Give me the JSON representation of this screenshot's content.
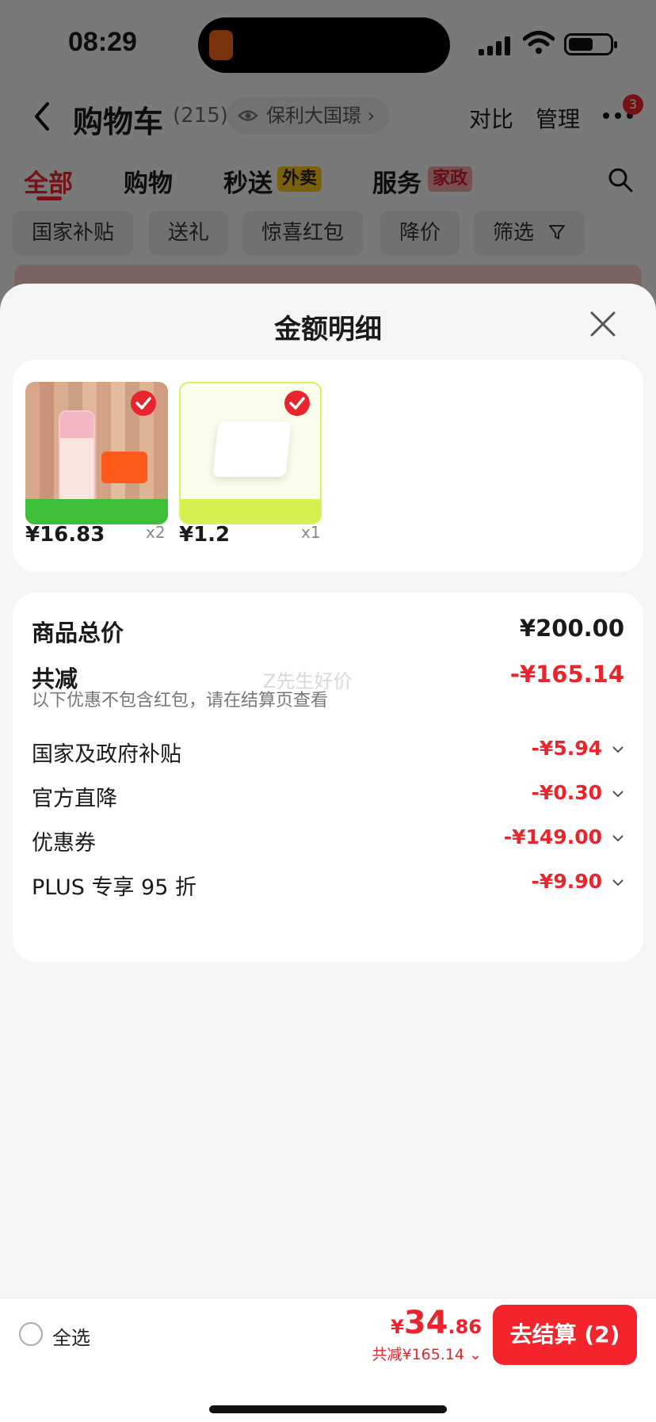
{
  "status": {
    "time": "08:29"
  },
  "nav": {
    "title": "购物车",
    "count": "(215)",
    "location": "保利大国璟",
    "compare": "对比",
    "manage": "管理",
    "badge": "3"
  },
  "tabs": [
    {
      "label": "全部",
      "active": true
    },
    {
      "label": "购物"
    },
    {
      "label": "秒送",
      "tag": "外卖"
    },
    {
      "label": "服务",
      "tag": "家政"
    }
  ],
  "filters": [
    "国家补贴",
    "送礼",
    "惊喜红包",
    "降价",
    "筛选"
  ],
  "sheet": {
    "title": "金额明细",
    "goods": [
      {
        "price": "¥16.83",
        "qty": "x2"
      },
      {
        "price": "¥1.2",
        "qty": "x1"
      }
    ],
    "total_label": "商品总价",
    "total_value": "¥200.00",
    "reduce_label": "共减",
    "reduce_value": "-¥165.14",
    "note": "以下优惠不包含红包，请在结算页查看",
    "watermark": "Z先生好价",
    "details": [
      {
        "label": "国家及政府补贴",
        "value": "-¥5.94"
      },
      {
        "label": "官方直降",
        "value": "-¥0.30"
      },
      {
        "label": "优惠券",
        "value": "-¥149.00"
      },
      {
        "label": "PLUS 专享 95 折",
        "value": "-¥9.90"
      }
    ]
  },
  "bottom": {
    "select_all": "全选",
    "price_currency": "¥",
    "price_int": "34",
    "price_dec": ".86",
    "saving": "共减¥165.14",
    "checkout": "去结算 (2)"
  },
  "colors": {
    "accent": "#e8242c",
    "checkout": "#f5232c"
  }
}
